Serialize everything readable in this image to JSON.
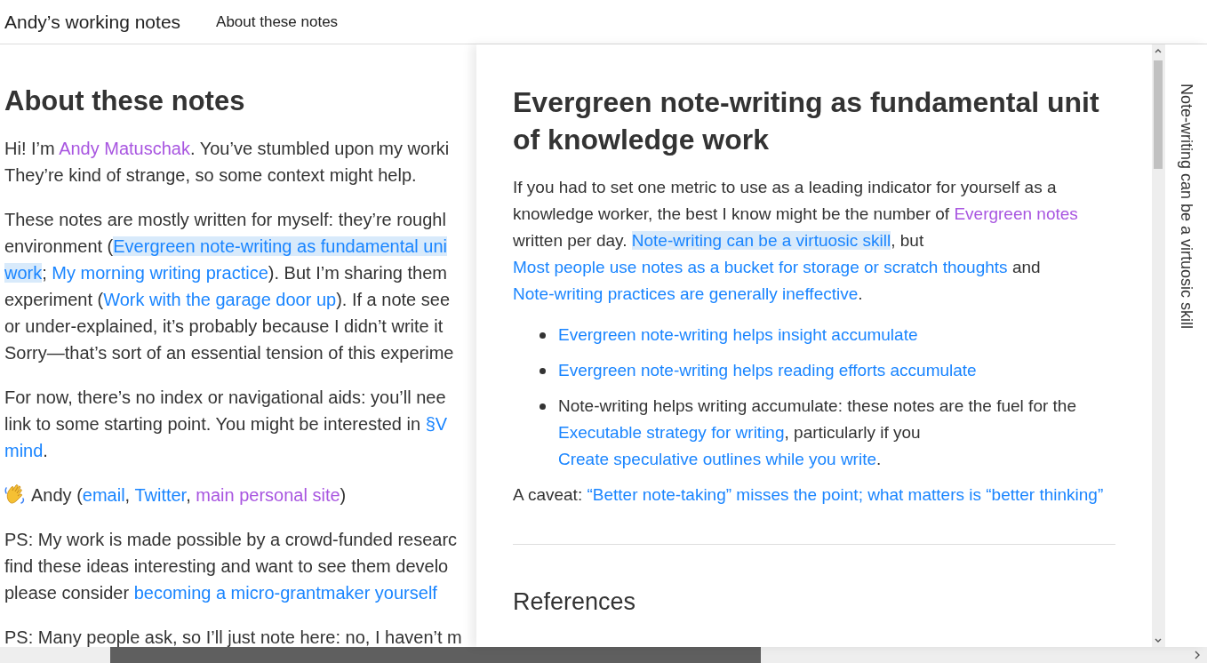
{
  "header": {
    "title": "Andy’s working notes",
    "nav": [
      {
        "label": "About these notes"
      }
    ]
  },
  "left_pane": {
    "title": "About these notes",
    "paragraphs": [
      {
        "kind": "text",
        "lines": [
          [
            {
              "text": "Hi! I’m ",
              "kind": "plain"
            },
            {
              "text": "Andy Matuschak",
              "kind": "visited",
              "highlighted": false
            },
            {
              "text": ". You’ve stumbled upon my worki",
              "kind": "plain"
            }
          ],
          [
            {
              "text": "They’re kind of strange, so some context might help.",
              "kind": "plain"
            }
          ]
        ]
      },
      {
        "kind": "text",
        "lines": [
          [
            {
              "text": "These notes are mostly written for myself: they’re roughl",
              "kind": "plain"
            }
          ],
          [
            {
              "text": "environment (",
              "kind": "plain"
            },
            {
              "text": "Evergreen note-writing as fundamental uni",
              "kind": "link",
              "highlighted": true
            }
          ],
          [
            {
              "text": "work",
              "kind": "link",
              "highlighted": true
            },
            {
              "text": "; ",
              "kind": "plain"
            },
            {
              "text": "My morning writing practice",
              "kind": "link",
              "highlighted": false
            },
            {
              "text": "). But I’m sharing them",
              "kind": "plain"
            }
          ],
          [
            {
              "text": "experiment (",
              "kind": "plain"
            },
            {
              "text": "Work with the garage door up",
              "kind": "link",
              "highlighted": false
            },
            {
              "text": "). If a note see",
              "kind": "plain"
            }
          ],
          [
            {
              "text": "or under-explained, it’s probably because I didn’t write it",
              "kind": "plain"
            }
          ],
          [
            {
              "text": "Sorry—that’s sort of an essential tension of this experime",
              "kind": "plain"
            }
          ]
        ]
      },
      {
        "kind": "text",
        "lines": [
          [
            {
              "text": "For now, there’s no index or navigational aids: you’ll nee",
              "kind": "plain"
            }
          ],
          [
            {
              "text": "link to some starting point. You might be interested in ",
              "kind": "plain"
            },
            {
              "text": "§V",
              "kind": "link",
              "highlighted": false
            }
          ],
          [
            {
              "text": "mind",
              "kind": "link",
              "highlighted": false
            },
            {
              "text": ".",
              "kind": "plain"
            }
          ]
        ]
      },
      {
        "kind": "signature",
        "lines": [
          [
            {
              "text": "Andy (",
              "kind": "plain"
            },
            {
              "text": "email",
              "kind": "link",
              "highlighted": false
            },
            {
              "text": ", ",
              "kind": "plain"
            },
            {
              "text": "Twitter",
              "kind": "link",
              "highlighted": false
            },
            {
              "text": ", ",
              "kind": "plain"
            },
            {
              "text": "main personal site",
              "kind": "visited",
              "highlighted": false
            },
            {
              "text": ")",
              "kind": "plain"
            }
          ]
        ]
      },
      {
        "kind": "text",
        "lines": [
          [
            {
              "text": "PS: My work is made possible by a crowd-funded researc",
              "kind": "plain"
            }
          ],
          [
            {
              "text": "find these ideas interesting and want to see them develo",
              "kind": "plain"
            }
          ],
          [
            {
              "text": "please consider ",
              "kind": "plain"
            },
            {
              "text": "becoming a micro-grantmaker yourself",
              "kind": "link",
              "highlighted": false
            }
          ]
        ]
      },
      {
        "kind": "text",
        "lines": [
          [
            {
              "text": "PS: Many people ask, so I’ll just note here: no, I haven’t m",
              "kind": "plain"
            }
          ]
        ]
      }
    ]
  },
  "right_pane": {
    "title": "Evergreen note-writing as fundamental unit of knowledge work",
    "blocks": [
      {
        "kind": "paragraph",
        "segments": [
          {
            "text": "If you had to set one metric to use as a leading indicator for yourself as a knowledge worker, the best I know might be the number of ",
            "kind": "plain"
          },
          {
            "text": "Evergreen notes",
            "kind": "visited",
            "highlighted": false
          },
          {
            "text": " written per day. ",
            "kind": "plain"
          },
          {
            "text": "Note-writing can be a virtuosic skill",
            "kind": "link",
            "highlighted": true
          },
          {
            "text": ", but ",
            "kind": "plain"
          },
          {
            "text": "Most people use notes as a bucket for storage or scratch thoughts",
            "kind": "link",
            "highlighted": false
          },
          {
            "text": " and ",
            "kind": "plain"
          },
          {
            "text": "Note-writing practices are generally ineffective",
            "kind": "link",
            "highlighted": false
          },
          {
            "text": ".",
            "kind": "plain"
          }
        ]
      },
      {
        "kind": "list",
        "items": [
          [
            {
              "text": "Evergreen note-writing helps insight accumulate",
              "kind": "link",
              "highlighted": false
            }
          ],
          [
            {
              "text": "Evergreen note-writing helps reading efforts accumulate",
              "kind": "link",
              "highlighted": false
            }
          ],
          [
            {
              "text": "Note-writing helps writing accumulate: these notes are the fuel for the ",
              "kind": "plain"
            },
            {
              "text": "Executable strategy for writing",
              "kind": "link",
              "highlighted": false
            },
            {
              "text": ", particularly if you ",
              "kind": "plain"
            },
            {
              "text": "Create speculative outlines while you write",
              "kind": "link",
              "highlighted": false
            },
            {
              "text": ".",
              "kind": "plain"
            }
          ]
        ]
      },
      {
        "kind": "paragraph",
        "segments": [
          {
            "text": "A caveat: ",
            "kind": "plain"
          },
          {
            "text": "“Better note-taking” misses the point; what matters is “better thinking”",
            "kind": "link",
            "highlighted": false
          }
        ]
      }
    ],
    "references_heading": "References"
  },
  "side_tab": {
    "title": "Note-writing can be a virtuosic skill"
  }
}
